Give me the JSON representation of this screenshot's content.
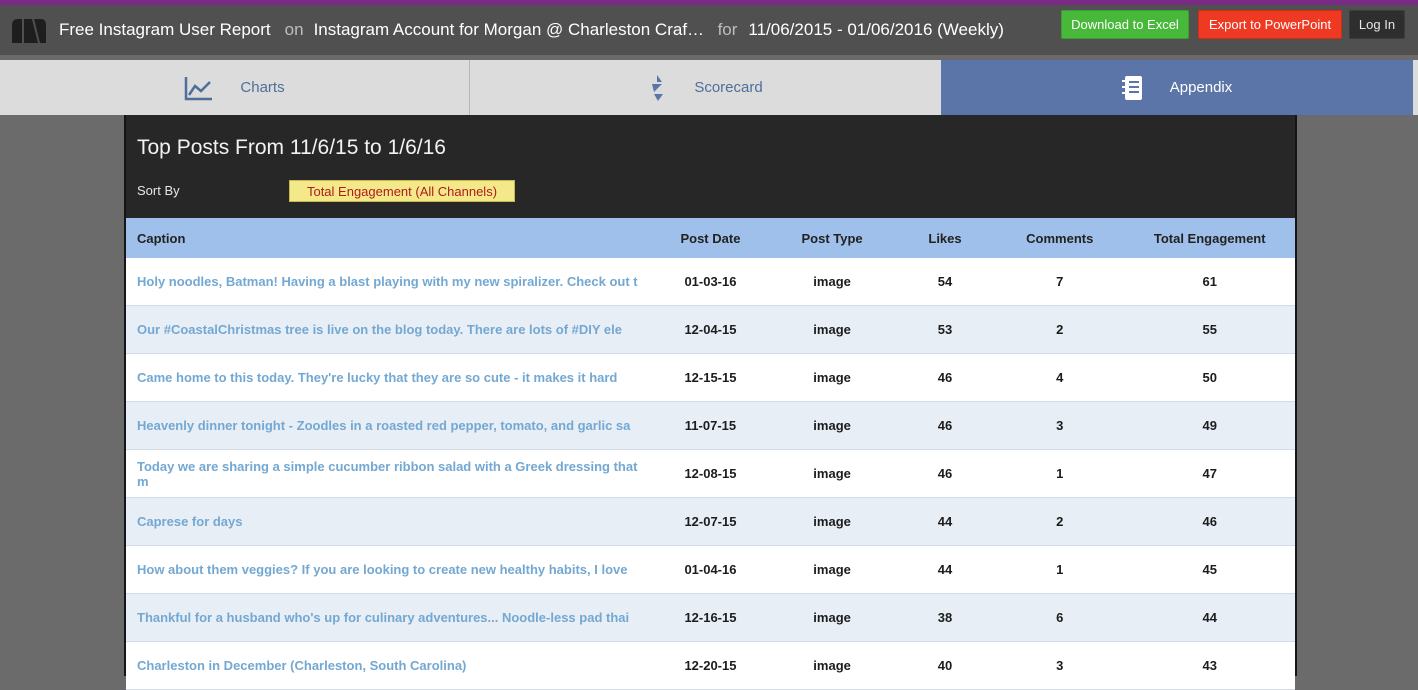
{
  "header": {
    "title": "Free Instagram User Report",
    "on": "on",
    "account": "Instagram Account for Morgan @ Charleston Craft…",
    "for": "for",
    "range": "11/06/2015 - 01/06/2016 (Weekly)",
    "download_label": "Download to Excel",
    "export_label": "Export to PowerPoint",
    "login_label": "Log In"
  },
  "tabs": [
    {
      "label": "Charts",
      "icon": "line-chart-icon"
    },
    {
      "label": "Scorecard",
      "icon": "scorecard-icon"
    },
    {
      "label": "Appendix",
      "icon": "notebook-icon"
    }
  ],
  "panel": {
    "title": "Top Posts From 11/6/15 to 1/6/16",
    "sort_label": "Sort By",
    "sort_value": "Total Engagement (All Channels)"
  },
  "table": {
    "headers": [
      "Caption",
      "Post Date",
      "Post Type",
      "Likes",
      "Comments",
      "Total Engagement"
    ],
    "rows": [
      [
        "Holy noodles, Batman! Having a blast playing with my new spiralizer. Check out t",
        "01-03-16",
        "image",
        "54",
        "7",
        "61"
      ],
      [
        "Our #CoastalChristmas tree is live on the blog today. There are lots of #DIY ele",
        "12-04-15",
        "image",
        "53",
        "2",
        "55"
      ],
      [
        "Came home to this today. They're lucky that they are so cute - it makes it hard",
        "12-15-15",
        "image",
        "46",
        "4",
        "50"
      ],
      [
        "Heavenly dinner tonight - Zoodles in a roasted red pepper, tomato, and garlic sa",
        "11-07-15",
        "image",
        "46",
        "3",
        "49"
      ],
      [
        "Today we are sharing a simple cucumber ribbon salad with a Greek dressing that m",
        "12-08-15",
        "image",
        "46",
        "1",
        "47"
      ],
      [
        "Caprese for days",
        "12-07-15",
        "image",
        "44",
        "2",
        "46"
      ],
      [
        "How about them veggies? If you are looking to create new healthy habits, I love",
        "01-04-16",
        "image",
        "44",
        "1",
        "45"
      ],
      [
        "Thankful for a husband who's up for culinary adventures... Noodle-less pad thai",
        "12-16-15",
        "image",
        "38",
        "6",
        "44"
      ],
      [
        "Charleston in December (Charleston, South Carolina)",
        "12-20-15",
        "image",
        "40",
        "3",
        "43"
      ]
    ]
  },
  "colors": {
    "accent_purple": "#7b2a86",
    "excel_green": "#47b83a",
    "ppt_red": "#ee3a23",
    "appendix_blue": "#5b75a8",
    "table_header": "#9ec0ea",
    "caption_link": "#73a8d2"
  }
}
